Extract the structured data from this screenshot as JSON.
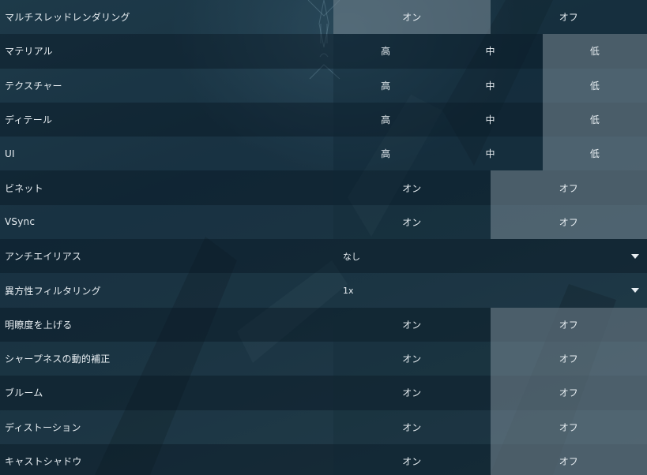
{
  "rows": [
    {
      "label": "マルチスレッドレンダリング",
      "type": "toggle",
      "options": [
        "オン",
        "オフ"
      ],
      "selected": 0
    },
    {
      "label": "マテリアル",
      "type": "tri",
      "options": [
        "高",
        "中",
        "低"
      ],
      "selected": 2
    },
    {
      "label": "テクスチャー",
      "type": "tri",
      "options": [
        "高",
        "中",
        "低"
      ],
      "selected": 2
    },
    {
      "label": "ディテール",
      "type": "tri",
      "options": [
        "高",
        "中",
        "低"
      ],
      "selected": 2
    },
    {
      "label": "UI",
      "type": "tri",
      "options": [
        "高",
        "中",
        "低"
      ],
      "selected": 2
    },
    {
      "label": "ビネット",
      "type": "toggle",
      "options": [
        "オン",
        "オフ"
      ],
      "selected": 1
    },
    {
      "label": "VSync",
      "type": "toggle",
      "options": [
        "オン",
        "オフ"
      ],
      "selected": 1
    },
    {
      "label": "アンチエイリアス",
      "type": "select",
      "value": "なし"
    },
    {
      "label": "異方性フィルタリング",
      "type": "select",
      "value": "1x"
    },
    {
      "label": "明瞭度を上げる",
      "type": "toggle",
      "options": [
        "オン",
        "オフ"
      ],
      "selected": 1
    },
    {
      "label": "シャープネスの動的補正",
      "type": "toggle",
      "options": [
        "オン",
        "オフ"
      ],
      "selected": 1
    },
    {
      "label": "ブルーム",
      "type": "toggle",
      "options": [
        "オン",
        "オフ"
      ],
      "selected": 1
    },
    {
      "label": "ディストーション",
      "type": "toggle",
      "options": [
        "オン",
        "オフ"
      ],
      "selected": 1
    },
    {
      "label": "キャストシャドウ",
      "type": "toggle",
      "options": [
        "オン",
        "オフ"
      ],
      "selected": 1
    }
  ],
  "icons": {
    "dropdown": "chevron-down-icon"
  }
}
